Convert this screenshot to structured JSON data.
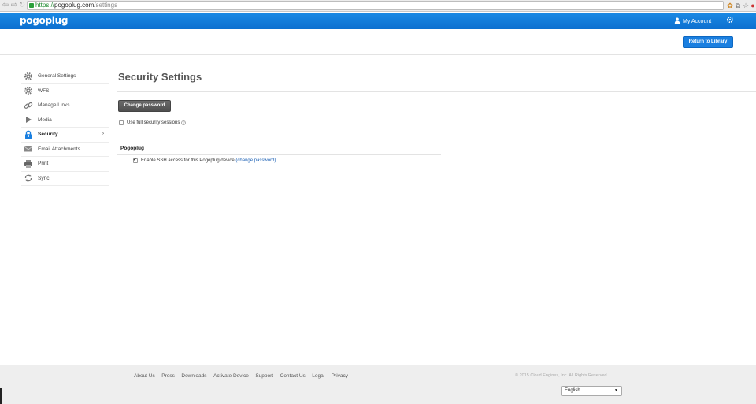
{
  "browser": {
    "url_scheme": "https://",
    "url_host": "pogoplug.com",
    "url_path": "/settings",
    "extension_badge": "14"
  },
  "header": {
    "logo": "pogoplug",
    "account_label": "My Account",
    "return_button": "Return to Library"
  },
  "colors": {
    "brand_blue": "#1a7fe0",
    "header_gradient_top": "#1a8ae5",
    "dark_button": "#555555",
    "link": "#1a5fb4"
  },
  "sidebar": {
    "items": [
      {
        "label": "General Settings",
        "icon": "gear-icon",
        "active": false
      },
      {
        "label": "WFS",
        "icon": "gear-icon",
        "active": false
      },
      {
        "label": "Manage Links",
        "icon": "link-icon",
        "active": false
      },
      {
        "label": "Media",
        "icon": "play-icon",
        "active": false
      },
      {
        "label": "Security",
        "icon": "lock-icon",
        "active": true
      },
      {
        "label": "Email Attachments",
        "icon": "envelope-icon",
        "active": false
      },
      {
        "label": "Print",
        "icon": "printer-icon",
        "active": false
      },
      {
        "label": "Sync",
        "icon": "sync-icon",
        "active": false
      }
    ],
    "active_arrow": "›"
  },
  "main": {
    "title": "Security Settings",
    "change_password_button": "Change password",
    "full_sessions_label": "Use full security sessions",
    "full_sessions_checked": false,
    "section_title": "Pogoplug",
    "ssh_label": "Enable SSH access for this Pogoplug device",
    "ssh_checked": true,
    "ssh_change_link": "(change password)"
  },
  "footer": {
    "links": [
      "About Us",
      "Press",
      "Downloads",
      "Activate Device",
      "Support",
      "Contact Us",
      "Legal",
      "Privacy"
    ],
    "copyright": "© 2015 Cloud Engines, Inc. All Rights Reserved",
    "language": "English"
  }
}
